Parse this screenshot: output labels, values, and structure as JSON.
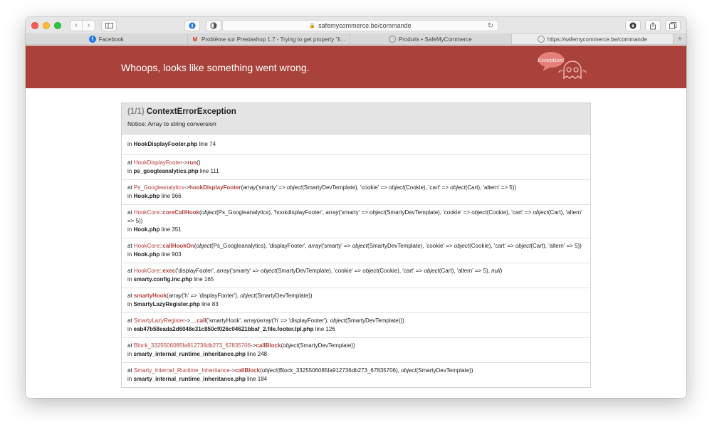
{
  "browser": {
    "url": "safemycommerce.be/commande",
    "tabs": [
      {
        "label": "Facebook",
        "icon": "facebook-icon"
      },
      {
        "label": "Problème sur Prestashop 1.7 - Trying to get property \"li...",
        "icon": "gmail-icon"
      },
      {
        "label": "Produits • SafeMyCommerce",
        "icon": "safemycommerce-icon"
      },
      {
        "label": "https://safemycommerce.be/commande",
        "icon": "safemycommerce-icon"
      }
    ]
  },
  "banner": {
    "title": "Whoops, looks like something went wrong.",
    "badge_text": "Exception!",
    "color": "#a8423a"
  },
  "exception": {
    "count": "(1/1)",
    "name": "ContextErrorException",
    "message": "Notice: Array to string conversion",
    "first": {
      "in": "in",
      "file": "HookDisplayFooter.php",
      "line": "line 74"
    }
  },
  "trace": [
    {
      "at": "at",
      "cls": "HookDisplayFooter",
      "sep": "->",
      "fn": "run",
      "args_pre": "(",
      "args": "",
      "args_post": ")",
      "in": "in",
      "file": "ps_googleanalytics.php",
      "line": "line 111"
    },
    {
      "at": "at",
      "cls": "Ps_Googleanalytics",
      "sep": "->",
      "fn": "hookDisplayFooter",
      "args_pre": "(",
      "args": "array('smarty' => object(SmartyDevTemplate), 'cookie' => object(Cookie), 'cart' => object(Cart), 'altern' => 5))",
      "args_post": "",
      "in": "in",
      "file": "Hook.php",
      "line": "line 966"
    },
    {
      "at": "at",
      "cls": "HookCore",
      "sep": "::",
      "fn": "coreCallHook",
      "args_pre": "(",
      "args": "object(Ps_Googleanalytics), 'hookdisplayFooter', array('smarty' => object(SmartyDevTemplate), 'cookie' => object(Cookie), 'cart' => object(Cart), 'altern' => 5))",
      "args_post": "",
      "in": "in",
      "file": "Hook.php",
      "line": "line 351"
    },
    {
      "at": "at",
      "cls": "HookCore",
      "sep": "::",
      "fn": "callHookOn",
      "args_pre": "(",
      "args": "object(Ps_Googleanalytics), 'displayFooter', array('smarty' => object(SmartyDevTemplate), 'cookie' => object(Cookie), 'cart' => object(Cart), 'altern' => 5))",
      "args_post": "",
      "in": "in",
      "file": "Hook.php",
      "line": "line 903"
    },
    {
      "at": "at",
      "cls": "HookCore",
      "sep": "::",
      "fn": "exec",
      "args_pre": "(",
      "args": "'displayFooter', array('smarty' => object(SmartyDevTemplate), 'cookie' => object(Cookie), 'cart' => object(Cart), 'altern' => 5), null)",
      "args_post": "",
      "in": "in",
      "file": "smarty.config.inc.php",
      "line": "line 165"
    },
    {
      "at": "at",
      "cls": "",
      "sep": "",
      "fn": "smartyHook",
      "args_pre": "(",
      "args": "array('h' => 'displayFooter'), object(SmartyDevTemplate))",
      "args_post": "",
      "in": "in",
      "file": "SmartyLazyRegister.php",
      "line": "line 83"
    },
    {
      "at": "at",
      "cls": "SmartyLazyRegister",
      "sep": "->",
      "fn": "__call",
      "args_pre": "(",
      "args": "'smartyHook', array(array('h' => 'displayFooter'), object(SmartyDevTemplate)))",
      "args_post": "",
      "in": "in",
      "file": "eab47b58eada2d6048e31c850cf026c04621bbaf_2.file.footer.tpl.php",
      "line": "line 126"
    },
    {
      "at": "at",
      "cls": "Block_3325506085fa912736db273_67835706",
      "sep": "->",
      "fn": "callBlock",
      "args_pre": "(",
      "args": "object(SmartyDevTemplate))",
      "args_post": "",
      "in": "in",
      "file": "smarty_internal_runtime_inheritance.php",
      "line": "line 248"
    },
    {
      "at": "at",
      "cls": "Smarty_Internal_Runtime_Inheritance",
      "sep": "->",
      "fn": "callBlock",
      "args_pre": "(",
      "args": "object(Block_3325506085fa912736db273_67835706), object(SmartyDevTemplate))",
      "args_post": "",
      "in": "in",
      "file": "smarty_internal_runtime_inheritance.php",
      "line": "line 184"
    }
  ]
}
